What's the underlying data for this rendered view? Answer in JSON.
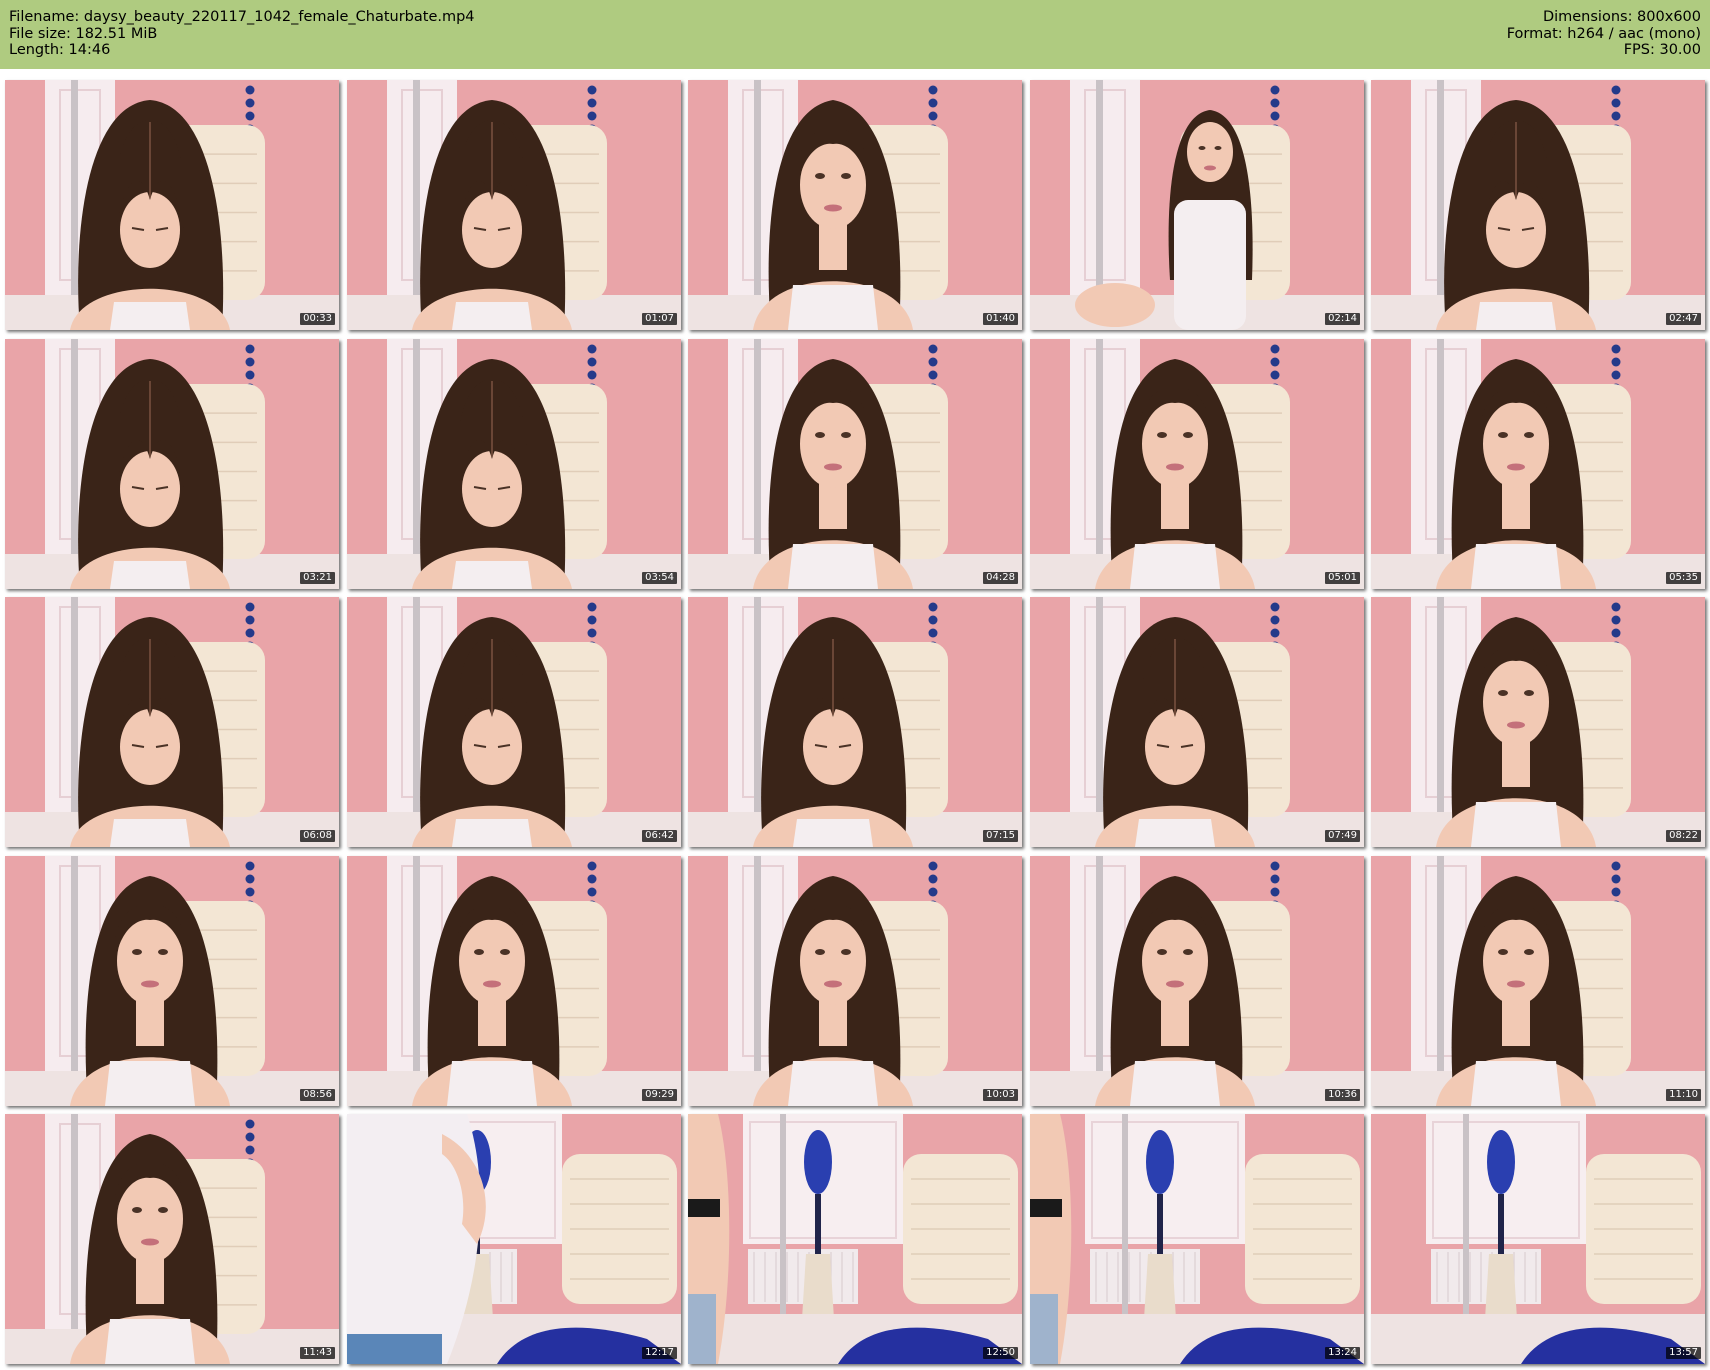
{
  "header": {
    "filename": "Filename: daysy_beauty_220117_1042_female_Chaturbate.mp4",
    "filesize": "File size: 182.51 MiB",
    "length": "Length: 14:46",
    "dimensions": "Dimensions: 800x600",
    "format": "Format: h264 / aac (mono)",
    "fps": "FPS: 30.00"
  },
  "colors": {
    "header_bg": "#afcb80",
    "wall_pink": "#e9a4a8",
    "chair_cream": "#f3e6d4",
    "hair_brown": "#3a2418",
    "skin": "#f2c9b4",
    "top_white": "#f4eef0",
    "accent_blue": "#2a3fb0"
  },
  "thumbnails": [
    {
      "time": "00:33",
      "scene": "looking-down"
    },
    {
      "time": "01:07",
      "scene": "looking-down"
    },
    {
      "time": "01:40",
      "scene": "face"
    },
    {
      "time": "02:14",
      "scene": "sitting-back"
    },
    {
      "time": "02:47",
      "scene": "looking-down"
    },
    {
      "time": "03:21",
      "scene": "looking-down"
    },
    {
      "time": "03:54",
      "scene": "looking-down"
    },
    {
      "time": "04:28",
      "scene": "face"
    },
    {
      "time": "05:01",
      "scene": "face"
    },
    {
      "time": "05:35",
      "scene": "face"
    },
    {
      "time": "06:08",
      "scene": "looking-down"
    },
    {
      "time": "06:42",
      "scene": "looking-down"
    },
    {
      "time": "07:15",
      "scene": "looking-down"
    },
    {
      "time": "07:49",
      "scene": "looking-down"
    },
    {
      "time": "08:22",
      "scene": "face"
    },
    {
      "time": "08:56",
      "scene": "face"
    },
    {
      "time": "09:29",
      "scene": "face"
    },
    {
      "time": "10:03",
      "scene": "face"
    },
    {
      "time": "10:36",
      "scene": "face"
    },
    {
      "time": "11:10",
      "scene": "face"
    },
    {
      "time": "11:43",
      "scene": "face"
    },
    {
      "time": "12:17",
      "scene": "room-person-side"
    },
    {
      "time": "12:50",
      "scene": "room-person-edge"
    },
    {
      "time": "13:24",
      "scene": "room-person-edge"
    },
    {
      "time": "13:57",
      "scene": "room-empty"
    }
  ]
}
